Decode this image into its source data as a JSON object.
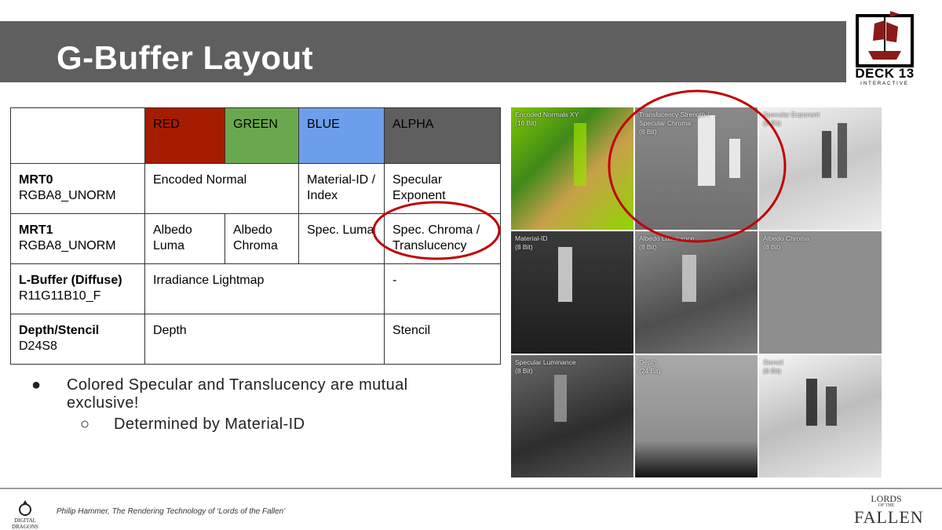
{
  "slide": {
    "title": "G-Buffer Layout",
    "brand": {
      "deck": "DECK 13",
      "interactive": "INTERACTIVE"
    }
  },
  "table": {
    "header": [
      "",
      "RED",
      "GREEN",
      "BLUE",
      "ALPHA"
    ],
    "rows": [
      {
        "name": "MRT0",
        "format": "RGBA8_UNORM",
        "c1": "Encoded Normal",
        "c2": "Material-ID / Index",
        "c3": "Specular Exponent"
      },
      {
        "name": "MRT1",
        "format": "RGBA8_UNORM",
        "c1": "Albedo Luma",
        "c2": "Albedo Chroma",
        "c3": "Spec. Luma",
        "c4": "Spec. Chroma / Translucency"
      },
      {
        "name": "L-Buffer (Diffuse)",
        "format": "R11G11B10_F",
        "c1": "Irradiance Lightmap",
        "c2": "-"
      },
      {
        "name": "Depth/Stencil",
        "format": "D24S8",
        "c1": "Depth",
        "c2": "Stencil"
      }
    ],
    "colors": {
      "red": "#a61c00",
      "green": "#6aa84f",
      "blue": "#6d9eeb",
      "alpha": "#5f5f5f"
    }
  },
  "bullets": {
    "main": "Colored Specular and Translucency are mutual exclusive!",
    "sub": "Determined by Material-ID"
  },
  "tiles": [
    {
      "l1": "Encoded Normals XY",
      "l2": "(16 Bit)"
    },
    {
      "l1": "Translucency Strength /",
      "l2": "Specular Chroma",
      "l3": "(8 Bit)"
    },
    {
      "l1": "Specular Exponent",
      "l2": "(8 Bit)"
    },
    {
      "l1": "Material-ID",
      "l2": "(8 Bit)"
    },
    {
      "l1": "Albedo Luminance",
      "l2": "(8 Bit)"
    },
    {
      "l1": "Albedo Chroma",
      "l2": "(8 Bit)"
    },
    {
      "l1": "Specular Luminance",
      "l2": "(8 Bit)"
    },
    {
      "l1": "Depth",
      "l2": "(24 Bit)"
    },
    {
      "l1": "Stencil",
      "l2": "(8 Bit)"
    }
  ],
  "highlight_color": "#c00000",
  "footer": {
    "credit": "Philip Hammer, The Rendering Technology of ‘Lords of the Fallen’",
    "left_logo": "DIGITAL DRAGONS",
    "right_logo": {
      "l1": "LORDS",
      "l2": "OF THE",
      "l3": "FALLEN"
    }
  }
}
